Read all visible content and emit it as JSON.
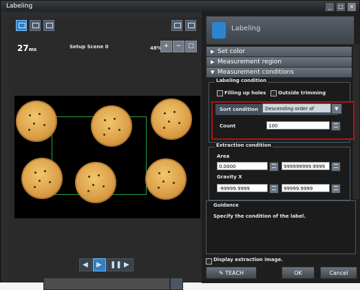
{
  "window": {
    "title": "Labeling"
  },
  "viewer": {
    "time_ms": "27",
    "time_unit": "ms",
    "scene": "Setup Scene 0",
    "zoom": "48%"
  },
  "panel": {
    "title": "Labeling",
    "sections": [
      {
        "label": "Set color",
        "expanded": false
      },
      {
        "label": "Measurement region",
        "expanded": false
      },
      {
        "label": "Measurement conditions",
        "expanded": true
      }
    ],
    "labeling_condition": {
      "title": "Labeling condition",
      "checkbox_1": "Filling up holes",
      "checkbox_2": "Outside trimming",
      "sort_label": "Sort condition",
      "sort_value": "Descending order of",
      "count_label": "Count",
      "count_value": "100"
    },
    "extraction_condition": {
      "title": "Extraction condition",
      "area_label": "Area",
      "area_min": "0.0000",
      "area_max": "999999999.9999",
      "gravity_x_label": "Gravity X",
      "gravity_x_min": "-99999.9999",
      "gravity_x_max": "99999.9999"
    },
    "guidance": {
      "title": "Guidance",
      "text": "Specify the condition of the label."
    },
    "display_extraction": "Display extraction image.",
    "buttons": {
      "teach": "TEACH",
      "ok": "OK",
      "cancel": "Cancel"
    }
  }
}
